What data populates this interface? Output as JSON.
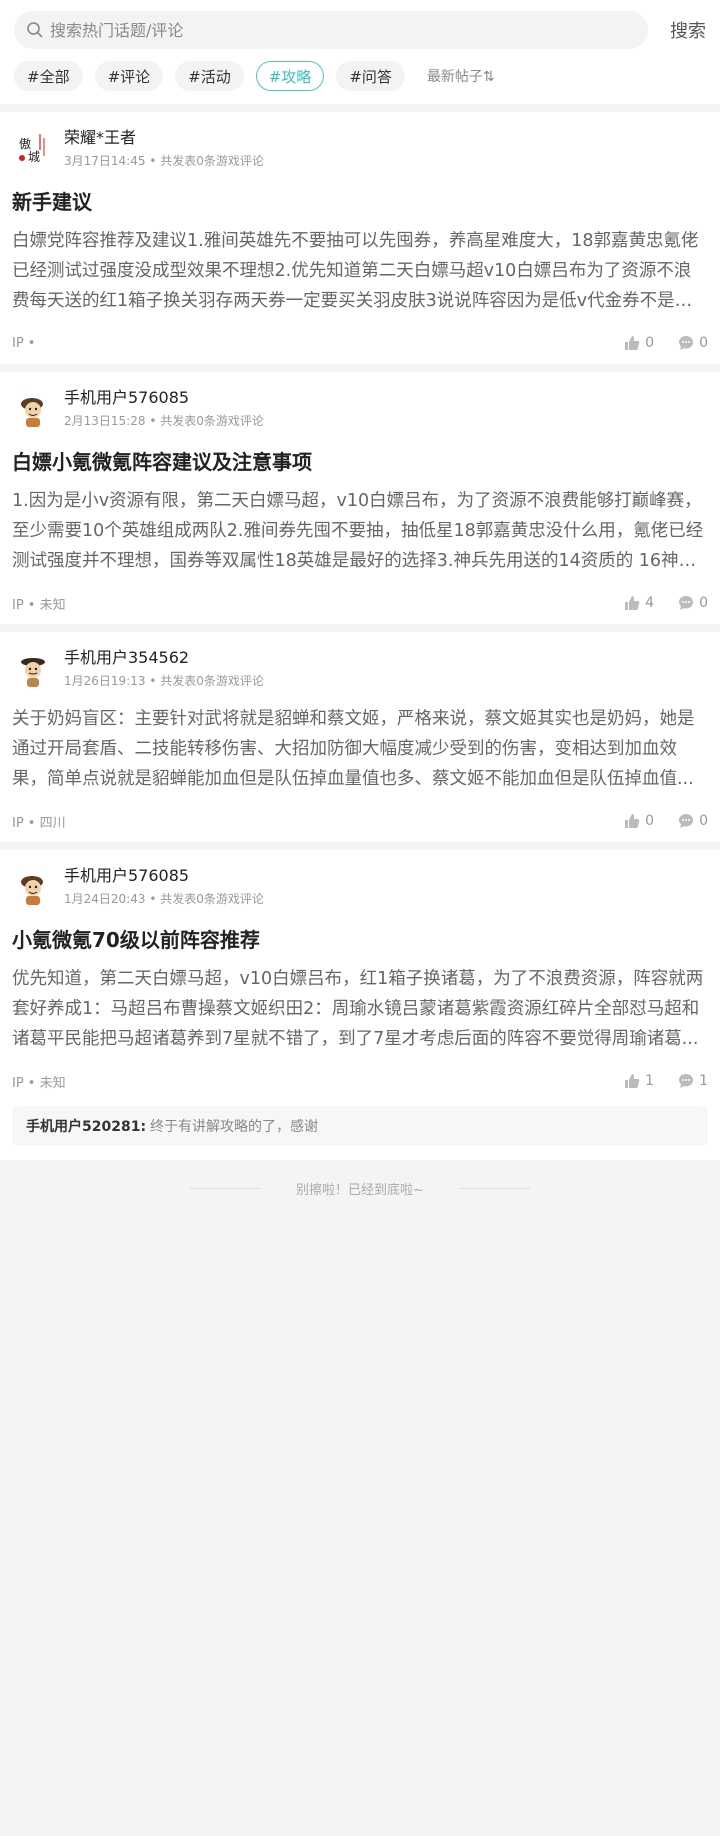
{
  "search": {
    "placeholder": "搜索热门话题/评论",
    "button_label": "搜索"
  },
  "tabs": [
    {
      "label": "#全部",
      "active": false
    },
    {
      "label": "#评论",
      "active": false
    },
    {
      "label": "#活动",
      "active": false
    },
    {
      "label": "#攻略",
      "active": true
    },
    {
      "label": "#问答",
      "active": false
    }
  ],
  "sort_label": "最新帖子⇅",
  "posts": [
    {
      "user": "荣耀*王者",
      "date": "3月17日14:45",
      "stats": "共发表0条游戏评论",
      "title": "新手建议",
      "content": "白嫖党阵容推荐及建议1.雅间英雄先不要抽可以先囤券，养高星难度大，18郭嘉黄忠氪佬已经测试过强度没成型效果不理想2.优先知道第二天白嫖马超v10白嫖吕布为了资源不浪费每天送的红1箱子换关羽存两天券一定要买关羽皮肤3说说阵容因为是低v代金券不是很多...",
      "ip": "IP •",
      "likes": "0",
      "comments": "0"
    },
    {
      "user": "手机用户576085",
      "date": "2月13日15:28",
      "stats": "共发表0条游戏评论",
      "title": "白嫖小氪微氪阵容建议及注意事项",
      "content": "1.因为是小v资源有限，第二天白嫖马超，v10白嫖吕布，为了资源不浪费能够打巅峰赛，至少需要10个英雄组成两队2.雅间券先囤不要抽，抽低星18郭嘉黄忠没什么用，氪佬已经测试强度并不理想，国券等双属性18英雄是最好的选择3.神兵先用送的14资质的 16神兵...",
      "ip": "IP • 未知",
      "likes": "4",
      "comments": "0"
    },
    {
      "user": "手机用户354562",
      "date": "1月26日19:13",
      "stats": "共发表0条游戏评论",
      "title": "",
      "content": "关于奶妈盲区：主要针对武将就是貂蝉和蔡文姬，严格来说，蔡文姬其实也是奶妈，她是通过开局套盾、二技能转移伤害、大招加防御大幅度减少受到的伤害，变相达到加血效果，简单点说就是貂蝉能加血但是队伍掉血量值也多、蔡文姬不能加血但是队伍掉血值...",
      "ip": "IP • 四川",
      "likes": "0",
      "comments": "0"
    },
    {
      "user": "手机用户576085",
      "date": "1月24日20:43",
      "stats": "共发表0条游戏评论",
      "title": "小氪微氪70级以前阵容推荐",
      "content": "优先知道，第二天白嫖马超，v10白嫖吕布，红1箱子换诸葛，为了不浪费资源，阵容就两套好养成1：马超吕布曹操蔡文姬织田2：周瑜水镜吕蒙诸葛紫霞资源红碎片全部怼马超和诸葛平民能把马超诸葛养到7星就不错了，到了7星才考虑后面的阵容不要觉得周瑜诸葛...",
      "ip": "IP • 未知",
      "likes": "1",
      "comments": "1",
      "reply": {
        "user": "手机用户520281:",
        "text": "终于有讲解攻略的了，感谢"
      }
    }
  ],
  "end_text": "别擦啦！已经到底啦~"
}
